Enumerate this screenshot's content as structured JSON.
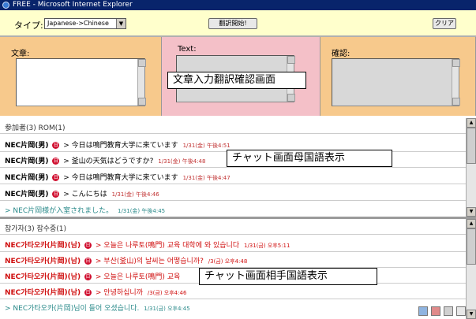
{
  "window": {
    "title": "FREE - Microsoft Internet Explorer"
  },
  "toolbar": {
    "type_label": "タイプ:",
    "type_value": "Japanese->Chinese",
    "translate_button": "翻訳開始!",
    "clear_button": "クリア"
  },
  "panels": {
    "source_label": "文章:",
    "text_label": "Text:",
    "confirm_label": "確認:"
  },
  "annotations": {
    "input_area": "文章入力翻訳確認画面",
    "chat_native": "チャット画面母国語表示",
    "chat_partner": "チャット画面相手国語表示"
  },
  "chat_native": {
    "header": "参加者(3) ROM(1)",
    "messages": [
      {
        "name": "NEC片岡(男)",
        "badge": "日",
        "text": "今日は鳴門教育大学に来ています",
        "time": "1/31(金) 午後4:51"
      },
      {
        "name": "NEC片岡(男)",
        "badge": "日",
        "text": "釜山の天気はどうですか?",
        "time": "1/31(金) 午後4:48"
      },
      {
        "name": "NEC片岡(男)",
        "badge": "日",
        "text": "今日は鳴門教育大学に来ています",
        "time": "1/31(金) 午後4:47"
      },
      {
        "name": "NEC片岡(男)",
        "badge": "日",
        "text": "こんにちは",
        "time": "1/31(金) 午後4:46"
      }
    ],
    "system": {
      "text": "> NEC片岡様が入室されました。",
      "time": "1/31(金) 午後4:45"
    }
  },
  "chat_partner": {
    "header": "참가자(3) 잠수중(1)",
    "messages": [
      {
        "name": "NEC가타오카(片岡)(남)",
        "badge": "日",
        "text": "오늘은 나루토(鳴門) 교육 대학에 와 있습니다",
        "time": "1/31(금) 오후5:11"
      },
      {
        "name": "NEC가타오카(片岡)(남)",
        "badge": "日",
        "text": "부산(釜山)의 날씨는 어떻습니까?",
        "time": "/3(금) 오후4:48"
      },
      {
        "name": "NEC가타오카(片岡)(남)",
        "badge": "日",
        "text": "오늘은 나루토(鳴門) 교육",
        "time": ""
      },
      {
        "name": "NEC가타오카(片岡)(남)",
        "badge": "日",
        "text": "안녕하십니까",
        "time": "/3(금) 오후4:46"
      }
    ],
    "system": {
      "text": "> NEC가타오카(片岡)님이 들어 오셨습니다.",
      "time": "1/31(금) 오후4:45"
    }
  },
  "colors": {
    "toolbar_bg": "#ffffcc",
    "panel_orange": "#f7c98c",
    "panel_pink": "#f4c0c8",
    "title_bar": "#08246b",
    "partner_text": "#d01010",
    "system_text": "#2a8a8a"
  }
}
